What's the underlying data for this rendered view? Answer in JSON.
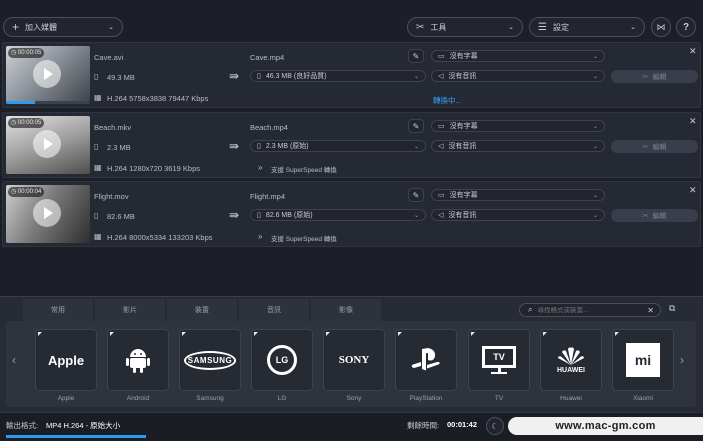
{
  "toolbar": {
    "add_media_label": "加入媒體",
    "tools_label": "工具",
    "settings_label": "設定"
  },
  "files": [
    {
      "duration": "00:00:05",
      "source_name": "Cave.avi",
      "source_size": "49.3 MB",
      "source_info": "H.264 5758x3838 79447 Kbps",
      "output_name": "Cave.mp4",
      "output_size": "46.3 MB (良好品質)",
      "status": "轉換中...",
      "subtitle": "沒有字幕",
      "audio": "沒有音訊",
      "edit_label": "編輯",
      "progress": 0.35
    },
    {
      "duration": "00:00:05",
      "source_name": "Beach.mkv",
      "source_size": "2.3 MB",
      "source_info": "H.264 1280x720 3619 Kbps",
      "output_name": "Beach.mp4",
      "output_size": "2.3 MB (原始)",
      "status": "支援 SuperSpeed 轉換",
      "subtitle": "沒有字幕",
      "audio": "沒有音訊",
      "edit_label": "編輯"
    },
    {
      "duration": "00:00:04",
      "source_name": "Flight.mov",
      "source_size": "82.6 MB",
      "source_info": "H.264 8000x5334 133203 Kbps",
      "output_name": "Flight.mp4",
      "output_size": "82.6 MB (原始)",
      "status": "支援 SuperSpeed 轉換",
      "subtitle": "沒有字幕",
      "audio": "沒有音訊",
      "edit_label": "編輯"
    }
  ],
  "format_panel": {
    "tabs": [
      "常用",
      "影片",
      "裝置",
      "音訊",
      "影像"
    ],
    "search_placeholder": "尋找格式或裝置...",
    "devices": [
      {
        "label": "Apple",
        "logo": "Apple"
      },
      {
        "label": "Android",
        "logo": "android-icon"
      },
      {
        "label": "Samsung",
        "logo": "SAMSUNG"
      },
      {
        "label": "LG",
        "logo": "LG"
      },
      {
        "label": "Sony",
        "logo": "SONY"
      },
      {
        "label": "PlayStation",
        "logo": "playstation-icon"
      },
      {
        "label": "TV",
        "logo": "TV"
      },
      {
        "label": "Huawei",
        "logo": "HUAWEI"
      },
      {
        "label": "Xiaomi",
        "logo": "mi"
      }
    ]
  },
  "status": {
    "output_format_label": "輸出格式:",
    "output_format_value": "MP4 H.264 - 原始大小",
    "remaining_label": "剩餘時間:",
    "remaining_value": "00:01:42",
    "watermark": "www.mac-gm.com"
  },
  "colors": {
    "accent": "#2e9bf0",
    "status_text": "#3aa0ff",
    "background": "#1c1f27"
  }
}
